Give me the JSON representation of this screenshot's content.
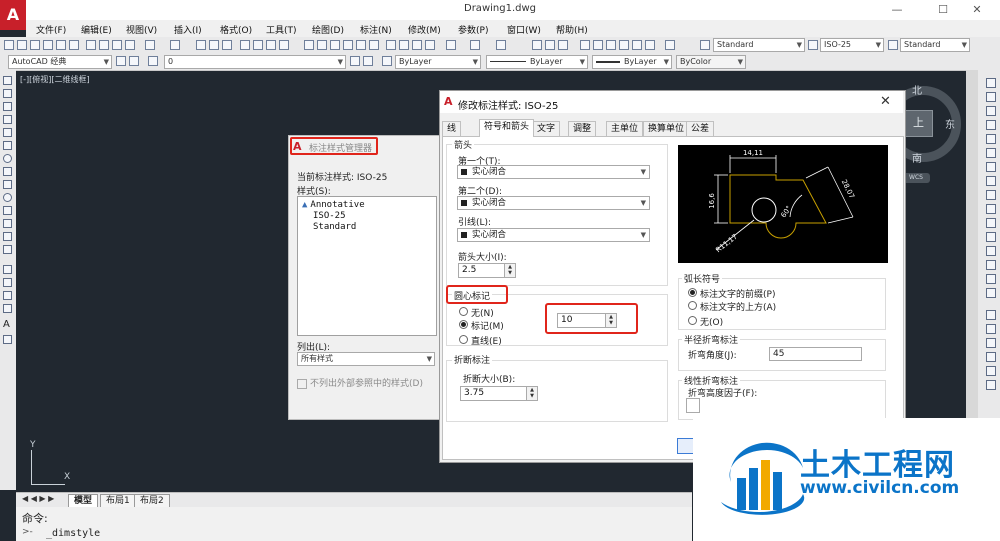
{
  "window": {
    "title": "Drawing1.dwg",
    "logo": "A",
    "minimize": "—",
    "maximize": "☐",
    "close": "✕"
  },
  "menu": [
    "文件(F)",
    "编辑(E)",
    "视图(V)",
    "插入(I)",
    "格式(O)",
    "工具(T)",
    "绘图(D)",
    "标注(N)",
    "修改(M)",
    "参数(P)",
    "窗口(W)",
    "帮助(H)"
  ],
  "toolbar": {
    "text_style": "Standard",
    "dim_style": "ISO-25",
    "table_style": "Standard",
    "workspace": "AutoCAD 经典",
    "layer": "0",
    "color": "ByLayer",
    "linetype": "ByLayer",
    "lineweight": "ByLayer",
    "plotstyle": "ByColor"
  },
  "viewport": {
    "label": "[-][俯视][二维线框]"
  },
  "viewcube": {
    "north": "北",
    "south": "南",
    "east": "东",
    "top": "上",
    "wcs": "WCS"
  },
  "ucs": {
    "x": "X",
    "y": "Y"
  },
  "layout_tabs": {
    "model": "模型",
    "layout1": "布局1",
    "layout2": "布局2",
    "nav": "◀ ◀ ▶ ▶"
  },
  "command": {
    "label": "命令:",
    "history": "_dimstyle",
    "prompt": ">-"
  },
  "manager": {
    "title": "标注样式管理器",
    "current_label": "当前标注样式: ISO-25",
    "styles_label": "样式(S):",
    "styles": [
      "Annotative",
      "ISO-25",
      "Standard"
    ],
    "list_label": "列出(L):",
    "list_value": "所有样式",
    "exclude_xref": "不列出外部参照中的样式(D)"
  },
  "dialog": {
    "title": "修改标注样式: ISO-25",
    "close": "✕",
    "tabs": [
      "线",
      "符号和箭头",
      "文字",
      "调整",
      "主单位",
      "换算单位",
      "公差"
    ],
    "arrowheads": {
      "group": "箭头",
      "first_label": "第一个(T):",
      "first_value": "实心闭合",
      "second_label": "第二个(D):",
      "second_value": "实心闭合",
      "leader_label": "引线(L):",
      "leader_value": "实心闭合",
      "size_label": "箭头大小(I):",
      "size_value": "2.5"
    },
    "center_marks": {
      "group": "圆心标记",
      "none": "无(N)",
      "mark": "标记(M)",
      "line": "直线(E)",
      "size_value": "10"
    },
    "dim_break": {
      "group": "折断标注",
      "size_label": "折断大小(B):",
      "size_value": "3.75"
    },
    "arc_length": {
      "group": "弧长符号",
      "preceding": "标注文字的前缀(P)",
      "above": "标注文字的上方(A)",
      "none": "无(O)"
    },
    "radius_jog": {
      "group": "半径折弯标注",
      "angle_label": "折弯角度(J):",
      "angle_value": "45"
    },
    "linear_jog": {
      "group": "线性折弯标注",
      "factor_label": "折弯高度因子(F):"
    },
    "preview": {
      "dim_top": "14,11",
      "dim_left": "16,6",
      "dim_right": "28,07",
      "angle": "60°",
      "radius": "R11,17"
    }
  },
  "watermark": {
    "title": "土木工程网",
    "url": "www.civilcn.com"
  },
  "colors": {
    "canvas": "#212830",
    "highlight": "#e0251b",
    "brand": "#0b74c8",
    "preview_lines": "#c8a000"
  }
}
